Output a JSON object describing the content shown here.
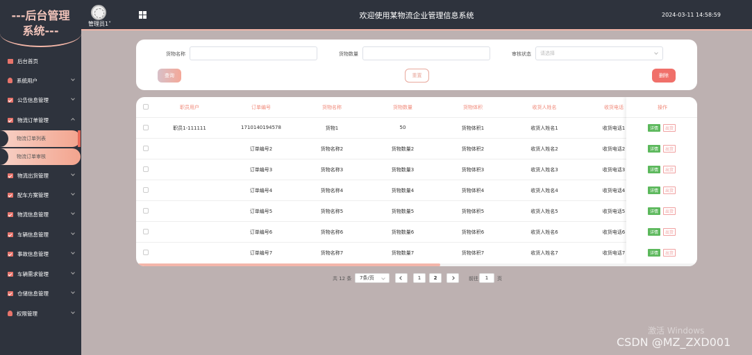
{
  "header": {
    "logo": "---后台管理系统---",
    "admin": "管理员1",
    "title": "欢迎使用某物流企业管理信息系统",
    "datetime": "2024-03-11 14:58:59"
  },
  "sidebar": {
    "items": [
      {
        "label": "后台首页"
      },
      {
        "label": "系统用户"
      },
      {
        "label": "公告信息管理"
      },
      {
        "label": "物流订单管理"
      },
      {
        "label": "物流出货管理"
      },
      {
        "label": "配车方案管理"
      },
      {
        "label": "物流信息管理"
      },
      {
        "label": "车辆信息管理"
      },
      {
        "label": "事故信息管理"
      },
      {
        "label": "车辆需求管理"
      },
      {
        "label": "仓储信息管理"
      },
      {
        "label": "权限管理"
      }
    ],
    "sub_items": [
      {
        "label": "物流订单列表"
      },
      {
        "label": "物流订单审核"
      }
    ]
  },
  "search": {
    "goods_name_label": "货物名称",
    "goods_name_value": "",
    "goods_qty_label": "货物数量",
    "goods_qty_value": "",
    "status_label": "审核状态",
    "status_placeholder": "请选择",
    "query": "查询",
    "reset": "重置",
    "delete": "删除"
  },
  "table": {
    "headers": [
      "职员用户",
      "订单编号",
      "货物名称",
      "货物数量",
      "货物体积",
      "收货人姓名",
      "收货电话",
      "操作"
    ],
    "rows": [
      [
        "职员1-111111",
        "1710140194578",
        "货物1",
        "50",
        "货物体积1",
        "收货人姓名1",
        "收货电话1"
      ],
      [
        "",
        "订单编号2",
        "货物名称2",
        "货物数量2",
        "货物体积2",
        "收货人姓名2",
        "收货电话2"
      ],
      [
        "",
        "订单编号3",
        "货物名称3",
        "货物数量3",
        "货物体积3",
        "收货人姓名3",
        "收货电话3"
      ],
      [
        "",
        "订单编号4",
        "货物名称4",
        "货物数量4",
        "货物体积4",
        "收货人姓名4",
        "收货电话4"
      ],
      [
        "",
        "订单编号5",
        "货物名称5",
        "货物数量5",
        "货物体积5",
        "收货人姓名5",
        "收货电话5"
      ],
      [
        "",
        "订单编号6",
        "货物名称6",
        "货物数量6",
        "货物体积6",
        "收货人姓名6",
        "收货电话6"
      ],
      [
        "",
        "订单编号7",
        "货物名称7",
        "货物数量7",
        "货物体积7",
        "收货人姓名7",
        "收货电话7"
      ]
    ],
    "detail": "详情",
    "out": "出货"
  },
  "pagination": {
    "total": "共 12 条",
    "page_size": "7条/页",
    "pages": [
      "1",
      "2"
    ],
    "goto": "前往",
    "goto_value": "1",
    "page_unit": "页"
  },
  "watermark": {
    "activate": "激活 Windows",
    "csdn": "CSDN @MZ_ZXD001"
  },
  "colors": {
    "sidebar_bg": "#2e333d",
    "accent": "#f08a7a",
    "content_bg": "#bdb1b1"
  }
}
